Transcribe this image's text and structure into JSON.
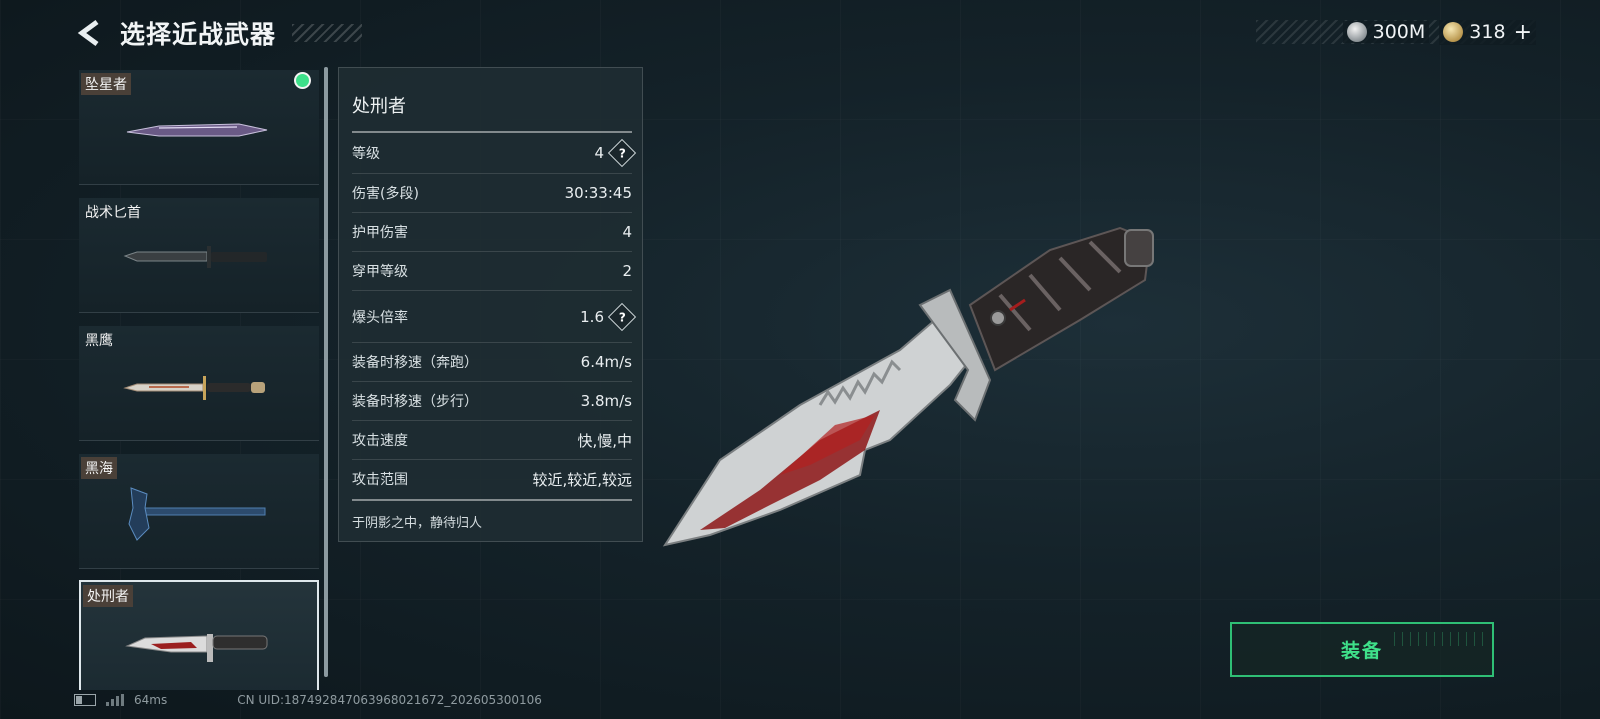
{
  "header": {
    "title": "选择近战武器",
    "currencies": [
      {
        "icon": "silver-coin-icon",
        "value": "300M"
      },
      {
        "icon": "gold-coin-icon",
        "value": "318"
      }
    ],
    "plus": "+"
  },
  "weapons": [
    {
      "name": "坠星者",
      "equipped": true,
      "tag_style": true
    },
    {
      "name": "战术匕首",
      "equipped": false,
      "tag_style": false
    },
    {
      "name": "黑鹰",
      "equipped": false,
      "tag_style": false
    },
    {
      "name": "黑海",
      "equipped": false,
      "tag_style": true
    },
    {
      "name": "处刑者",
      "equipped": false,
      "tag_style": true,
      "selected": true
    }
  ],
  "detail": {
    "name": "处刑者",
    "stats": [
      {
        "label": "等级",
        "value": "4",
        "help": true
      },
      {
        "label": "伤害(多段)",
        "value": "30:33:45"
      },
      {
        "label": "护甲伤害",
        "value": "4"
      },
      {
        "label": "穿甲等级",
        "value": "2"
      },
      {
        "label": "爆头倍率",
        "value": "1.6",
        "help": true
      },
      {
        "label": "装备时移速（奔跑）",
        "value": "6.4m/s"
      },
      {
        "label": "装备时移速（步行）",
        "value": "3.8m/s"
      },
      {
        "label": "攻击速度",
        "value": "快,慢,中"
      },
      {
        "label": "攻击范围",
        "value": "较近,较近,较远"
      }
    ],
    "help_symbol": "?",
    "description": "于阴影之中，静待归人"
  },
  "equip_button": {
    "label": "装备"
  },
  "status": {
    "ping": "64ms",
    "uid": "CN UID:187492847063968021672_202605300106"
  },
  "colors": {
    "accent_green": "#3fe18a",
    "background": "#142229"
  }
}
